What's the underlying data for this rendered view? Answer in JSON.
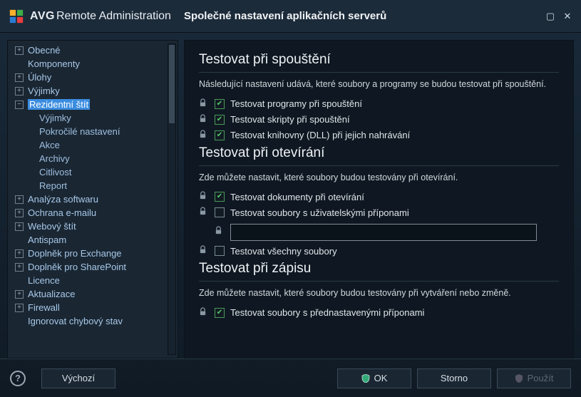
{
  "brand": {
    "bold": "AVG",
    "light": "Remote Administration"
  },
  "title": "Společné nastavení aplikačních serverů",
  "sidebar": {
    "items": [
      {
        "label": "Obecné",
        "exp": "+"
      },
      {
        "label": "Komponenty"
      },
      {
        "label": "Úlohy",
        "exp": "+"
      },
      {
        "label": "Výjimky",
        "exp": "+"
      },
      {
        "label": "Rezidentní štít",
        "exp": "−",
        "selected": true,
        "children": [
          {
            "label": "Výjimky"
          },
          {
            "label": "Pokročilé nastavení"
          },
          {
            "label": "Akce"
          },
          {
            "label": "Archivy"
          },
          {
            "label": "Citlivost"
          },
          {
            "label": "Report"
          }
        ]
      },
      {
        "label": "Analýza softwaru",
        "exp": "+"
      },
      {
        "label": "Ochrana e-mailu",
        "exp": "+"
      },
      {
        "label": "Webový štít",
        "exp": "+"
      },
      {
        "label": "Antispam"
      },
      {
        "label": "Doplněk pro Exchange",
        "exp": "+"
      },
      {
        "label": "Doplněk pro SharePoint",
        "exp": "+"
      },
      {
        "label": "Licence"
      },
      {
        "label": "Aktualizace",
        "exp": "+"
      },
      {
        "label": "Firewall",
        "exp": "+"
      },
      {
        "label": "Ignorovat chybový stav"
      }
    ]
  },
  "content": {
    "s1": {
      "title": "Testovat při spouštění",
      "desc": "Následující nastavení udává, které soubory a programy se budou testovat při spouštění.",
      "opts": [
        {
          "label": "Testovat programy při spouštění",
          "checked": true
        },
        {
          "label": "Testovat skripty při spouštění",
          "checked": true
        },
        {
          "label": "Testovat knihovny (DLL) při jejich nahrávání",
          "checked": true
        }
      ]
    },
    "s2": {
      "title": "Testovat při otevírání",
      "desc": "Zde můžete nastavit, které soubory budou testovány při otevírání.",
      "opts": [
        {
          "label": "Testovat dokumenty při otevírání",
          "checked": true
        },
        {
          "label": "Testovat soubory s uživatelskými příponami",
          "checked": false,
          "input": ""
        },
        {
          "label": "Testovat všechny soubory",
          "checked": false
        }
      ]
    },
    "s3": {
      "title": "Testovat při zápisu",
      "desc": "Zde můžete nastavit, které soubory budou testovány při vytváření nebo změně.",
      "opts": [
        {
          "label": "Testovat soubory s přednastavenými příponami",
          "checked": true
        }
      ]
    }
  },
  "footer": {
    "default": "Výchozí",
    "ok": "OK",
    "cancel": "Storno",
    "apply": "Použít"
  }
}
